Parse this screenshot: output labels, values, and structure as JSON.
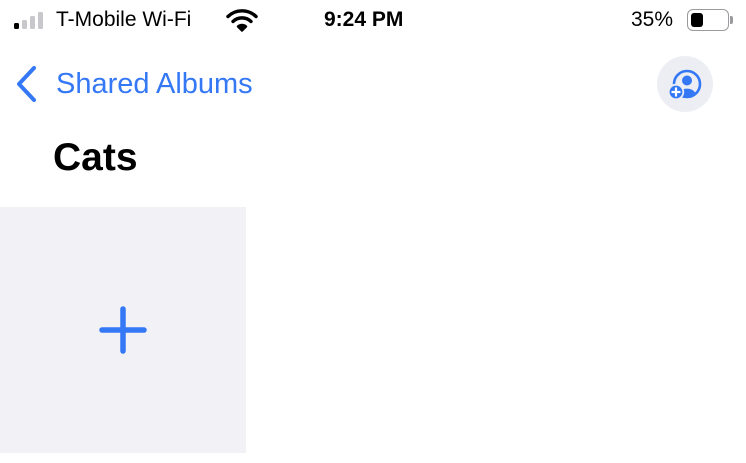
{
  "status_bar": {
    "carrier": "T-Mobile Wi-Fi",
    "time": "9:24 PM",
    "battery_percent": "35%",
    "battery_level": 0.35,
    "signal_bars_active": 1,
    "signal_bars_total": 4,
    "icons": [
      "cellular-signal-icon",
      "wifi-icon",
      "battery-icon"
    ]
  },
  "nav": {
    "back_label": "Shared Albums",
    "back_icon": "chevron-left-icon",
    "people_icon": "add-person-icon"
  },
  "album": {
    "title": "Cats",
    "add_icon": "plus-icon"
  },
  "colors": {
    "accent": "#3478f6",
    "tile_background": "#f1f1f6",
    "people_button_background": "#eceef3",
    "signal_active": "#000000",
    "signal_inactive": "#c7c7cc"
  }
}
